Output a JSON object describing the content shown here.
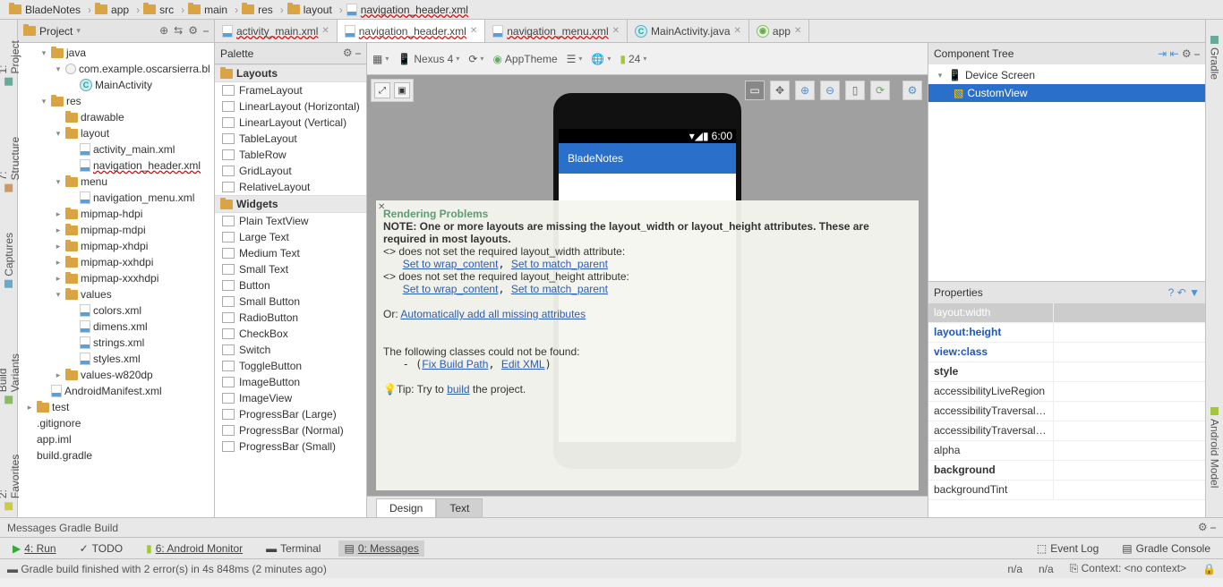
{
  "breadcrumbs": [
    "BladeNotes",
    "app",
    "src",
    "main",
    "res",
    "layout",
    "navigation_header.xml"
  ],
  "project_header": {
    "title": "Project"
  },
  "project_tree": {
    "items": [
      {
        "depth": 1,
        "caret": "▾",
        "icon": "folder",
        "label": "java"
      },
      {
        "depth": 2,
        "caret": "▾",
        "icon": "pkg",
        "label": "com.example.oscarsierra.bl"
      },
      {
        "depth": 3,
        "caret": "",
        "icon": "class",
        "label": "MainActivity"
      },
      {
        "depth": 1,
        "caret": "▾",
        "icon": "folder",
        "label": "res"
      },
      {
        "depth": 2,
        "caret": "",
        "icon": "folder",
        "label": "drawable"
      },
      {
        "depth": 2,
        "caret": "▾",
        "icon": "folder",
        "label": "layout"
      },
      {
        "depth": 3,
        "caret": "",
        "icon": "xml",
        "label": "activity_main.xml"
      },
      {
        "depth": 3,
        "caret": "",
        "icon": "xml",
        "label": "navigation_header.xml",
        "ul": true
      },
      {
        "depth": 2,
        "caret": "▾",
        "icon": "folder",
        "label": "menu"
      },
      {
        "depth": 3,
        "caret": "",
        "icon": "xml",
        "label": "navigation_menu.xml"
      },
      {
        "depth": 2,
        "caret": "▸",
        "icon": "folder",
        "label": "mipmap-hdpi"
      },
      {
        "depth": 2,
        "caret": "▸",
        "icon": "folder",
        "label": "mipmap-mdpi"
      },
      {
        "depth": 2,
        "caret": "▸",
        "icon": "folder",
        "label": "mipmap-xhdpi"
      },
      {
        "depth": 2,
        "caret": "▸",
        "icon": "folder",
        "label": "mipmap-xxhdpi"
      },
      {
        "depth": 2,
        "caret": "▸",
        "icon": "folder",
        "label": "mipmap-xxxhdpi"
      },
      {
        "depth": 2,
        "caret": "▾",
        "icon": "folder",
        "label": "values"
      },
      {
        "depth": 3,
        "caret": "",
        "icon": "xml",
        "label": "colors.xml"
      },
      {
        "depth": 3,
        "caret": "",
        "icon": "xml",
        "label": "dimens.xml"
      },
      {
        "depth": 3,
        "caret": "",
        "icon": "xml",
        "label": "strings.xml"
      },
      {
        "depth": 3,
        "caret": "",
        "icon": "xml",
        "label": "styles.xml"
      },
      {
        "depth": 2,
        "caret": "▸",
        "icon": "folder",
        "label": "values-w820dp"
      },
      {
        "depth": 1,
        "caret": "",
        "icon": "xml",
        "label": "AndroidManifest.xml"
      },
      {
        "depth": 0,
        "caret": "▸",
        "icon": "folder",
        "label": "test"
      },
      {
        "depth": 0,
        "caret": "",
        "icon": "",
        "label": ".gitignore"
      },
      {
        "depth": 0,
        "caret": "",
        "icon": "",
        "label": "app.iml"
      },
      {
        "depth": 0,
        "caret": "",
        "icon": "",
        "label": "build.gradle"
      }
    ]
  },
  "tabs": [
    {
      "icon": "xml",
      "label": "activity_main.xml",
      "ul": true,
      "active": false
    },
    {
      "icon": "xml",
      "label": "navigation_header.xml",
      "ul": true,
      "active": true
    },
    {
      "icon": "xml",
      "label": "navigation_menu.xml",
      "ul": true,
      "active": false
    },
    {
      "icon": "class",
      "label": "MainActivity.java",
      "ul": false,
      "active": false
    },
    {
      "icon": "mod",
      "label": "app",
      "ul": false,
      "active": false
    }
  ],
  "palette": {
    "title": "Palette",
    "sections": [
      {
        "title": "Layouts",
        "items": [
          "FrameLayout",
          "LinearLayout (Horizontal)",
          "LinearLayout (Vertical)",
          "TableLayout",
          "TableRow",
          "GridLayout",
          "RelativeLayout"
        ]
      },
      {
        "title": "Widgets",
        "items": [
          "Plain TextView",
          "Large Text",
          "Medium Text",
          "Small Text",
          "Button",
          "Small Button",
          "RadioButton",
          "CheckBox",
          "Switch",
          "ToggleButton",
          "ImageButton",
          "ImageView",
          "ProgressBar (Large)",
          "ProgressBar (Normal)",
          "ProgressBar (Small)"
        ]
      }
    ]
  },
  "design_toolbar": {
    "device": "Nexus 4",
    "theme": "AppTheme",
    "api": "24"
  },
  "phone": {
    "status_time": "6:00",
    "app_title": "BladeNotes"
  },
  "render": {
    "title": "Rendering Problems",
    "note": "NOTE: One or more layouts are missing the layout_width or layout_height attributes. These are required in most layouts.",
    "l1": "<> does not set the required layout_width attribute:",
    "l1a": "Set to wrap_content",
    "l1b": "Set to match_parent",
    "l2": "<> does not set the required layout_height attribute:",
    "l2a": "Set to wrap_content",
    "l2b": "Set to match_parent",
    "or": "Or: ",
    "or_link": "Automatically add all missing attributes",
    "cls": "The following classes could not be found:",
    "cls_a": "Fix Build Path",
    "cls_b": "Edit XML",
    "tip_pre": "Tip: Try to ",
    "tip_link": "build",
    "tip_post": " the project."
  },
  "design_tabs": {
    "design": "Design",
    "text": "Text"
  },
  "comp_tree": {
    "title": "Component Tree",
    "root": "Device Screen",
    "child": "CustomView"
  },
  "properties": {
    "title": "Properties",
    "rows": [
      {
        "k": "layout:width",
        "v": "",
        "h": true
      },
      {
        "k": "layout:height",
        "v": "",
        "b": true
      },
      {
        "k": "view:class",
        "v": "",
        "b": true
      },
      {
        "k": "style",
        "v": "",
        "bold": true
      },
      {
        "k": "accessibilityLiveRegion",
        "v": ""
      },
      {
        "k": "accessibilityTraversalAfte",
        "v": ""
      },
      {
        "k": "accessibilityTraversalBefo",
        "v": ""
      },
      {
        "k": "alpha",
        "v": ""
      },
      {
        "k": "background",
        "v": "",
        "bold": true
      },
      {
        "k": "backgroundTint",
        "v": ""
      }
    ]
  },
  "msg_bar": "Messages Gradle Build",
  "bottom_tabs": {
    "run": "4: Run",
    "todo": "TODO",
    "monitor": "6: Android Monitor",
    "terminal": "Terminal",
    "messages": "0: Messages",
    "eventlog": "Event Log",
    "gradle": "Gradle Console"
  },
  "footer": {
    "status": "Gradle build finished with 2 error(s) in 4s 848ms (2 minutes ago)",
    "col": "n/a",
    "line": "n/a",
    "ctx": "Context: <no context>"
  },
  "side_tabs": {
    "project": "1: Project",
    "structure": "7: Structure",
    "captures": "Captures",
    "variants": "Build Variants",
    "favorites": "2: Favorites",
    "gradle": "Gradle",
    "model": "Android Model"
  }
}
